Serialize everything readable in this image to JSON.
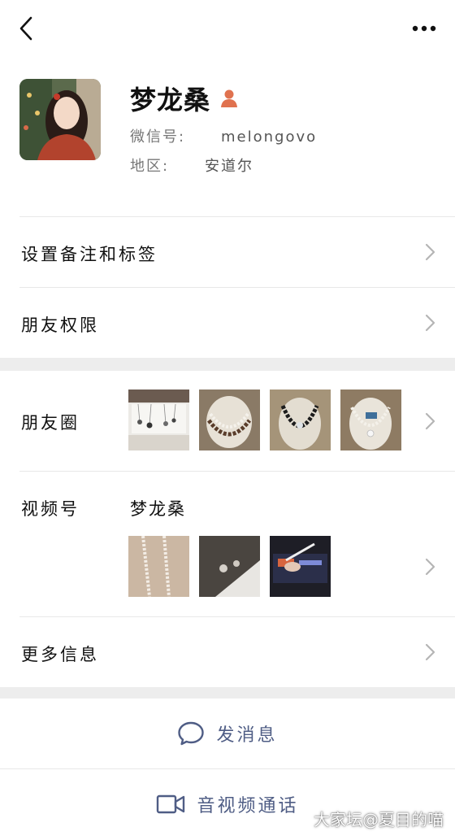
{
  "header": {
    "back_icon": "chevron-left-icon",
    "more_icon": "ellipsis-icon"
  },
  "profile": {
    "name": "梦龙桑",
    "gender_icon": "person-female-icon",
    "wechat_id_label": "微信号:",
    "wechat_id": "melongovo",
    "region_label": "地区:",
    "region": "安道尔"
  },
  "settings": {
    "remarks_tags": "设置备注和标签",
    "friend_permissions": "朋友权限"
  },
  "moments": {
    "label": "朋友圈"
  },
  "channels": {
    "label": "视频号",
    "name": "梦龙桑"
  },
  "more_info": {
    "label": "更多信息"
  },
  "actions": {
    "send_message": "发消息",
    "video_call": "音视频通话"
  },
  "watermark": "大家坛@夏目的喵",
  "colors": {
    "action_blue": "#4f5d85",
    "separator_gray": "#ededed"
  }
}
